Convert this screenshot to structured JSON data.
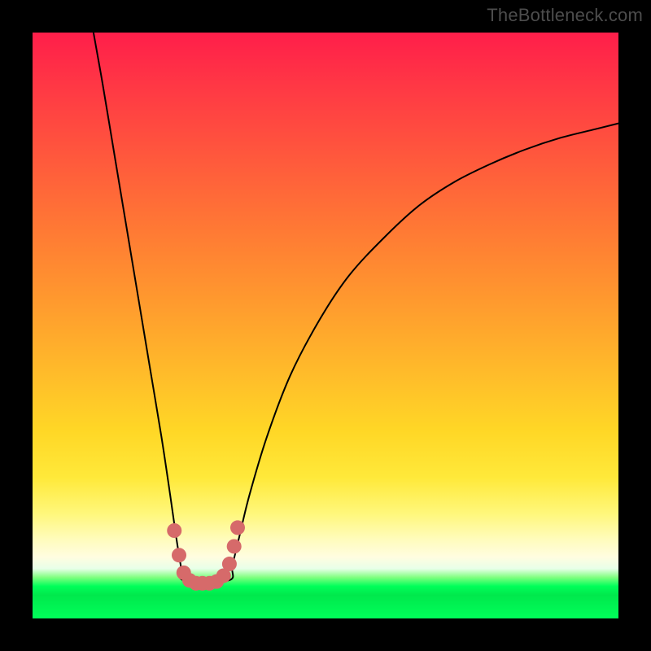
{
  "watermark": "TheBottleneck.com",
  "chart_data": {
    "type": "line",
    "title": "",
    "xlabel": "",
    "ylabel": "",
    "xlim": [
      0,
      100
    ],
    "ylim": [
      0,
      100
    ],
    "grid": false,
    "legend": false,
    "note": "Values are relative (percent of plot width/height); no numeric axis labels are present in the source image.",
    "series": [
      {
        "name": "main-curve",
        "color": "#000000",
        "stroke_width": 2,
        "x": [
          10.4,
          12,
          14,
          16,
          18,
          20,
          22,
          23.5,
          24.5,
          25.3,
          25.8,
          33.5,
          34.1,
          35.3,
          37,
          40,
          44,
          49,
          54,
          60,
          66,
          72,
          78,
          84,
          90,
          96,
          100
        ],
        "y": [
          100,
          91,
          79,
          67,
          55,
          43,
          31,
          21,
          14,
          9,
          6.5,
          6.5,
          9,
          14,
          21,
          31,
          41.5,
          51,
          58.5,
          65,
          70.5,
          74.5,
          77.5,
          80,
          82,
          83.5,
          84.5
        ]
      },
      {
        "name": "highlight-points",
        "color": "#d66a6a",
        "marker": "circle",
        "marker_radius": 9,
        "x": [
          24.2,
          25.0,
          25.8,
          26.8,
          27.9,
          29.0,
          30.2,
          31.4,
          32.6,
          33.6,
          34.4,
          35.0
        ],
        "y": [
          15.0,
          10.8,
          7.8,
          6.5,
          6.0,
          6.0,
          6.0,
          6.3,
          7.3,
          9.3,
          12.3,
          15.5
        ]
      }
    ]
  }
}
